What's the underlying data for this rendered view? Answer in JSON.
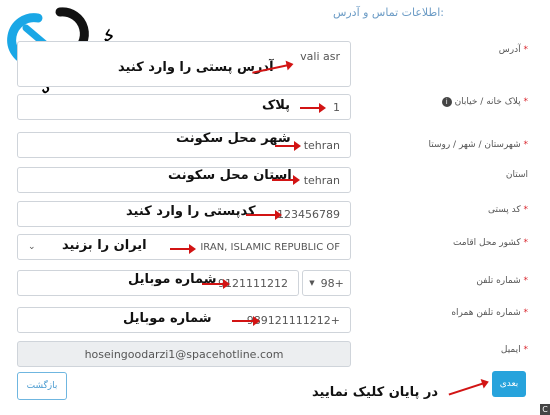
{
  "header": "اطلاعات تماس و آدرس:",
  "logo": {
    "text": "کپی ترید بیننس"
  },
  "form": {
    "address": {
      "label": "آدرس",
      "value": "vali asr",
      "note": "آدرس پستی را وارد کنید"
    },
    "plaque": {
      "label": "پلاک خانه / خیابان",
      "value": "1",
      "note": "پلاک"
    },
    "city": {
      "label": "شهرستان / شهر / روستا",
      "value": "tehran",
      "note": "شهر محل سکونت"
    },
    "province": {
      "label": "استان",
      "value": "tehran",
      "note": "استان محل سکونت"
    },
    "postal": {
      "label": "کد پستی",
      "value": "123456789",
      "note": "کدپستی را وارد کنید"
    },
    "country": {
      "label": "کشور محل اقامت",
      "value": "IRAN, ISLAMIC REPUBLIC OF",
      "note": "ایران را بزنید"
    },
    "phone": {
      "label": "شماره تلفن",
      "code": "98+",
      "value": "9121111212",
      "note": "شماره موبایل"
    },
    "mobile": {
      "label": "شماره تلفن همراه",
      "value": "989121111212+",
      "note": "شماره موبایل"
    },
    "email": {
      "label": "ایمیل",
      "value": "hoseingoodarzi1@spacehotline.com"
    }
  },
  "buttons": {
    "back": "بازگشت",
    "next": "بعدی",
    "note": "در پایان کلیک نمایید"
  },
  "corner": "C",
  "colors": {
    "accent": "#27a3dc",
    "arrow": "#d21414",
    "required": "#d9262d"
  }
}
